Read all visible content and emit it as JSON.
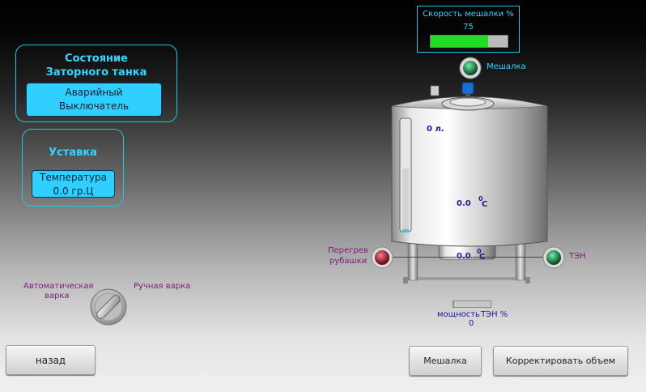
{
  "state_panel": {
    "title_line1": "Состояние",
    "title_line2": "Заторного танка",
    "status_line1": "Аварийный",
    "status_line2": "Выключатель"
  },
  "setpoint_panel": {
    "title": "Уставка",
    "line1": "Температура",
    "line2": "0.0 гр.Ц"
  },
  "speed_panel": {
    "title": "Скорость мешалки %",
    "value": "75",
    "fill_percent": 75
  },
  "mixer_label": "Мешалка",
  "tank": {
    "volume": "0 л.",
    "temp_main": "0.0",
    "temp_bottom": "0.0",
    "deg_symbol": "0",
    "unit_c": "C"
  },
  "overheat_label_line1": "Перегрев",
  "overheat_label_line2": "рубашки",
  "heater_label": "ТЭН",
  "heater_power": {
    "label_left": "мощность",
    "label_right": "ТЭН %",
    "value": "0",
    "fill_percent": 3
  },
  "mode_switch": {
    "auto_line1": "Автоматическая",
    "auto_line2": "варка",
    "manual": "Ручная варка"
  },
  "buttons": {
    "back": "назад",
    "mixer": "Мешалка",
    "correct_volume": "Корректировать объем"
  },
  "colors": {
    "accent": "#1fc6e0",
    "title": "#38d4ff",
    "box": "#2fd0ff",
    "indicator_green": "#0c7a3a",
    "indicator_red": "#b0102a",
    "label_purple": "#7a1a7a",
    "bar_green": "#22dd22"
  }
}
